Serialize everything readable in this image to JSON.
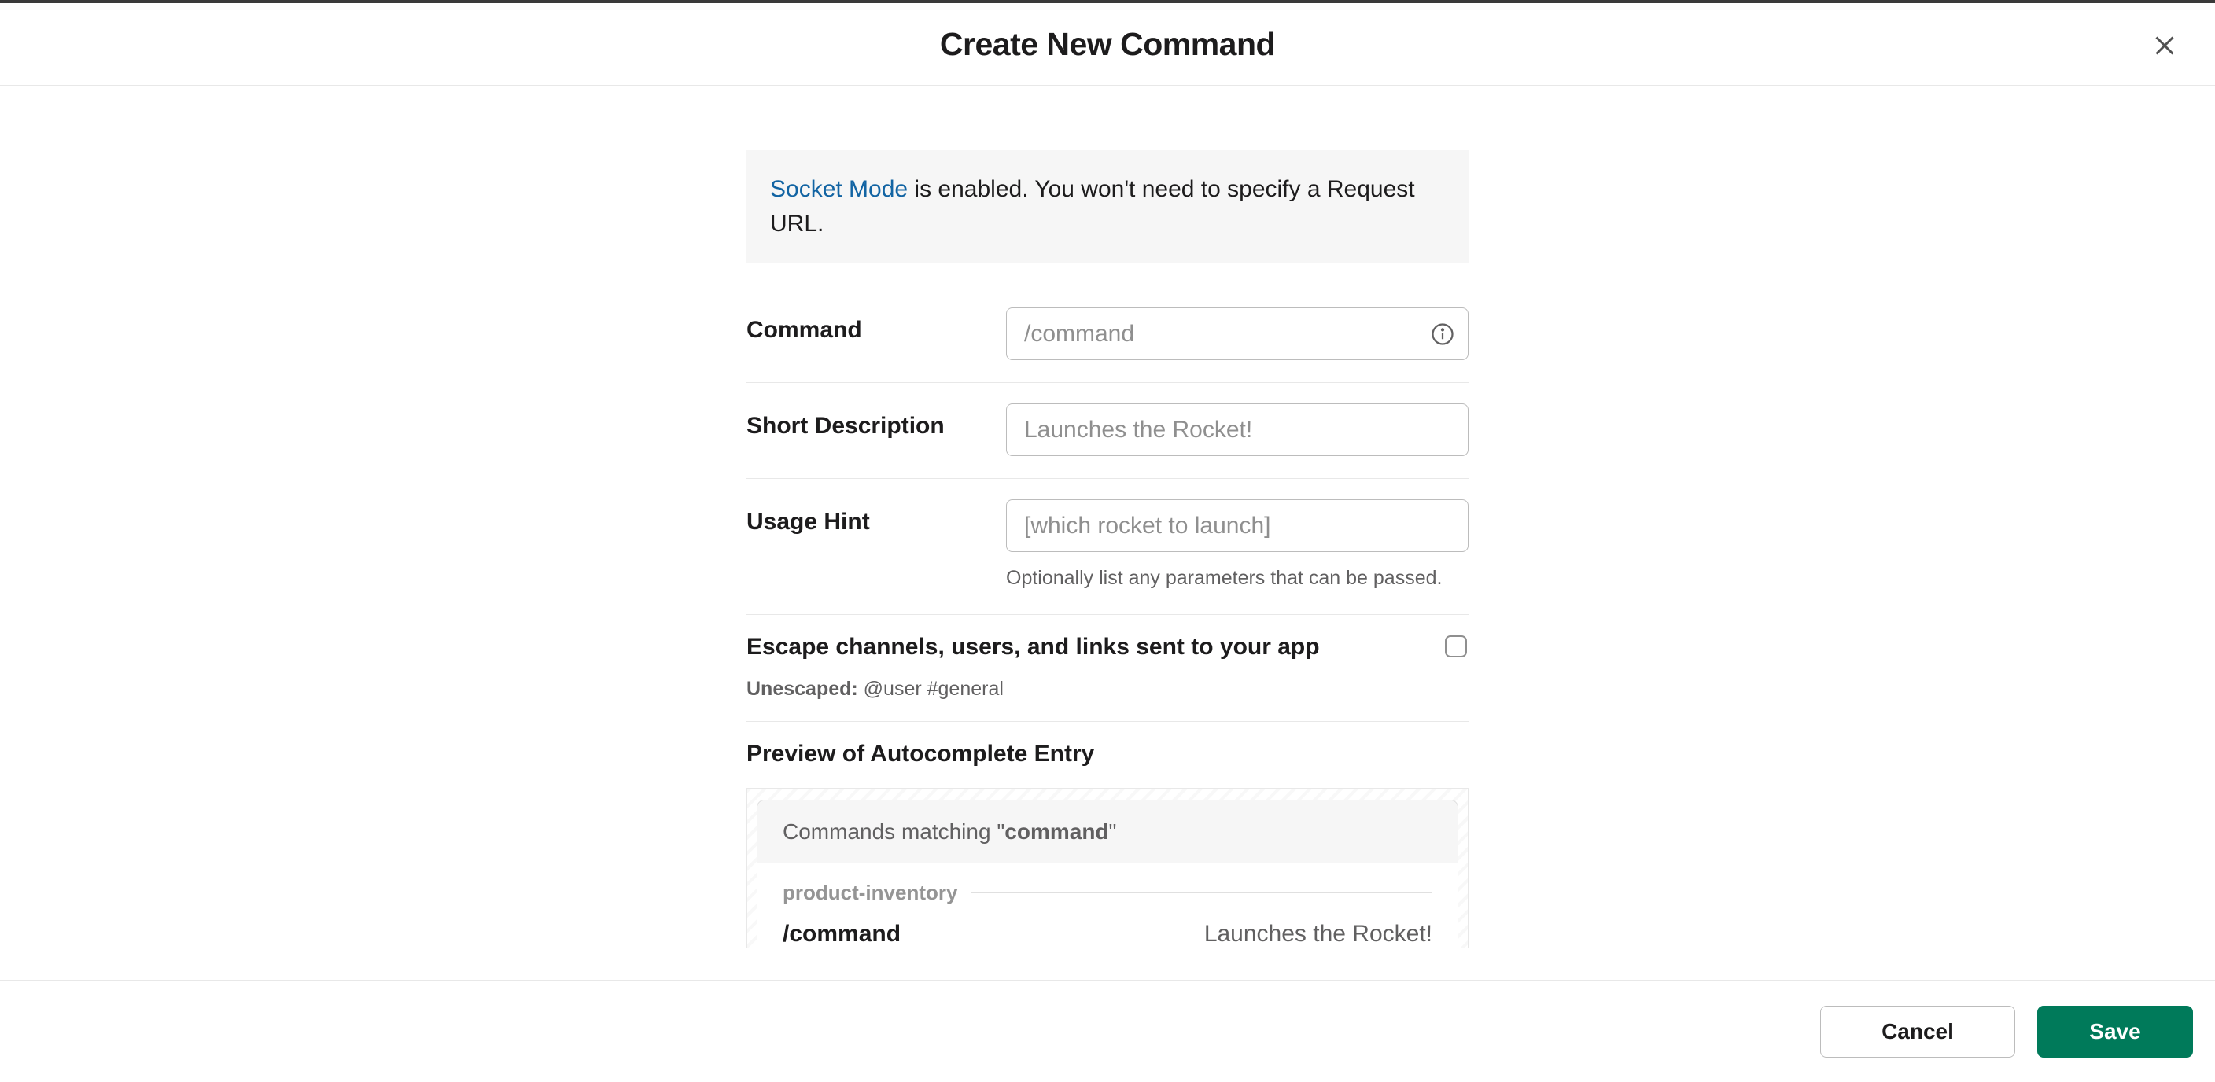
{
  "header": {
    "title": "Create New Command"
  },
  "banner": {
    "link_text": "Socket Mode",
    "text_after": " is enabled. You won't need to specify a Request URL."
  },
  "fields": {
    "command": {
      "label": "Command",
      "placeholder": "/command",
      "value": ""
    },
    "short_description": {
      "label": "Short Description",
      "placeholder": "Launches the Rocket!",
      "value": ""
    },
    "usage_hint": {
      "label": "Usage Hint",
      "placeholder": "[which rocket to launch]",
      "value": "",
      "help": "Optionally list any parameters that can be passed."
    }
  },
  "escape": {
    "label": "Escape channels, users, and links sent to your app",
    "sub_prefix": "Unescaped:",
    "sub_value": " @user #general"
  },
  "preview": {
    "title": "Preview of Autocomplete Entry",
    "match_prefix": "Commands matching \"",
    "match_term": "command",
    "match_suffix": "\"",
    "app_name": "product-inventory",
    "cmd_name": "/command",
    "cmd_desc": "Launches the Rocket!"
  },
  "footer": {
    "cancel": "Cancel",
    "save": "Save"
  }
}
